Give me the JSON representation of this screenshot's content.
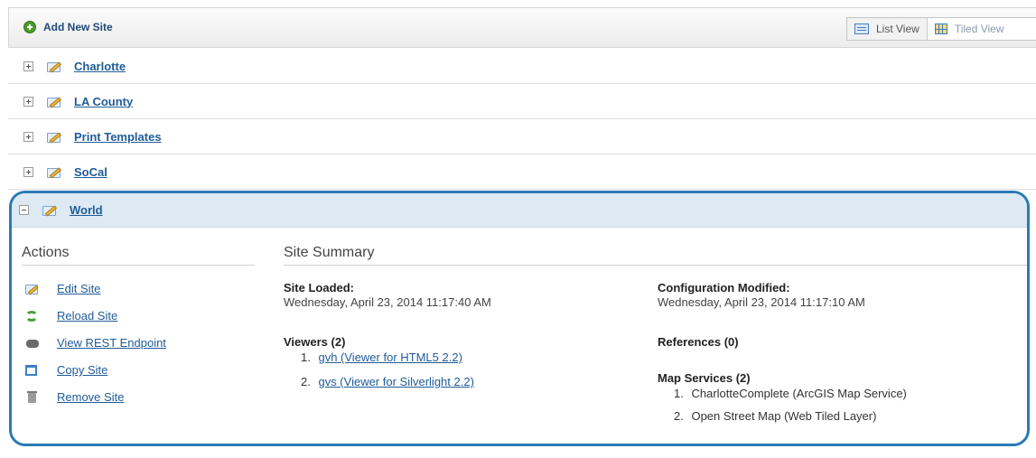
{
  "toolbar": {
    "add_site_label": "Add New Site",
    "list_view_label": "List View",
    "tiled_view_label": "Tiled View"
  },
  "sites": [
    {
      "name": "Charlotte",
      "expanded": false
    },
    {
      "name": "LA County",
      "expanded": false
    },
    {
      "name": "Print Templates",
      "expanded": false
    },
    {
      "name": "SoCal",
      "expanded": false
    },
    {
      "name": "World",
      "expanded": true
    }
  ],
  "details": {
    "actions_title": "Actions",
    "actions": [
      {
        "label": "Edit Site",
        "icon": "edit-icon"
      },
      {
        "label": "Reload Site",
        "icon": "reload-icon"
      },
      {
        "label": "View REST Endpoint",
        "icon": "rest-endpoint-icon"
      },
      {
        "label": "Copy Site",
        "icon": "copy-icon"
      },
      {
        "label": "Remove Site",
        "icon": "trash-icon"
      }
    ],
    "summary_title": "Site Summary",
    "site_loaded_label": "Site Loaded:",
    "site_loaded_value": "Wednesday, April 23, 2014 11:17:40 AM",
    "config_modified_label": "Configuration Modified:",
    "config_modified_value": "Wednesday, April 23, 2014 11:17:10 AM",
    "viewers_label": "Viewers (2)",
    "viewers": [
      {
        "num": "1.",
        "label": "gvh (Viewer for HTML5 2.2)"
      },
      {
        "num": "2.",
        "label": "gvs (Viewer for Silverlight 2.2)"
      }
    ],
    "references_label": "References (0)",
    "map_services_label": "Map Services (2)",
    "map_services": [
      {
        "num": "1.",
        "label": "CharlotteComplete (ArcGIS Map Service)"
      },
      {
        "num": "2.",
        "label": "Open Street Map (Web Tiled Layer)"
      }
    ]
  },
  "colors": {
    "accent": "#2a7bb5",
    "link": "#1f5b99",
    "expanded_header": "#dde9f3"
  }
}
